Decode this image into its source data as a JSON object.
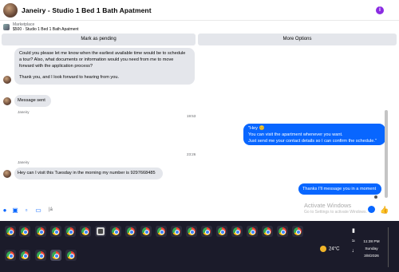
{
  "header": {
    "title": "Janeiry - Studio 1 Bed 1 Bath Apatment"
  },
  "listing": {
    "source": "Marketplace",
    "detail": "$500 · Studio 1 Bed 1 Bath Apatment"
  },
  "actions": {
    "pending_label": "Mark as pending",
    "more_label": "More Options"
  },
  "messages": {
    "inquiry": {
      "line1": "Could you please let me know when the earliest available time would be to schedule",
      "line2": "a tour? Also, what documents or information would you need from me to move",
      "line3": "forward with the application process?",
      "line4": "Thank you, and I look forward to hearing from you."
    },
    "sender_1": "Janeiry",
    "sent_notice": "Message sent",
    "time_1": "19:53",
    "reply_1": {
      "line1": "\"Hey 😊",
      "line2": "You can visit the apartment whenever you want.",
      "line3": "Just send me your contact details so I can confirm the schedule.\""
    },
    "time_2": "23:26",
    "sender_2": "Janeiry",
    "visit_request": "Hey can I visit this Tuesday in the morning my number is 9297668485",
    "reply_2": "Thanks I'll message you in a moment"
  },
  "composer": {
    "typing_text": "|á",
    "watermark_title": "Activate Windows",
    "watermark_sub": "Go to Settings to activate Windows."
  },
  "taskbar": {
    "temperature": "24°C",
    "time": "11:28 PM",
    "day": "Sunday",
    "date": "3/8/2026"
  },
  "colors": {
    "accent": "#0866ff",
    "bubble_in": "#e4e6eb",
    "taskbar": "#1b1b2a"
  }
}
